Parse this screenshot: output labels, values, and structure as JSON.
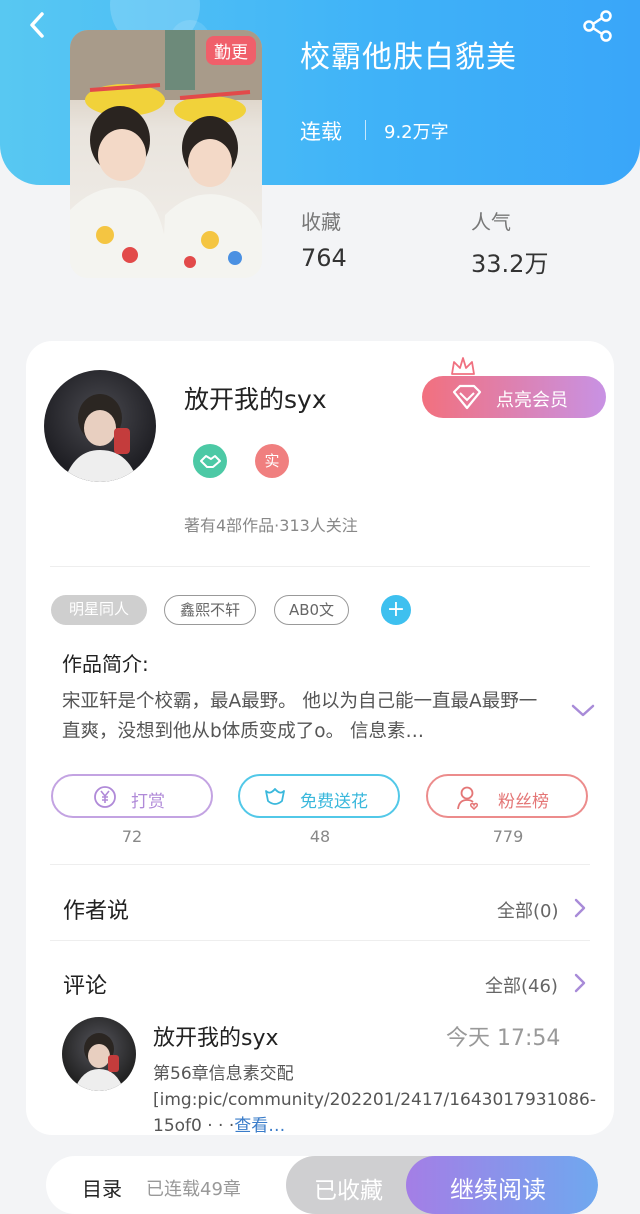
{
  "colors": {
    "header_gradient_start": "#58c8f2",
    "header_gradient_end": "#3aa6f9",
    "badge_red": "#f05f6a",
    "vip_gradient_start": "#f2707e",
    "vip_gradient_end": "#c892e4",
    "tip_purple": "#c3a3e2",
    "flower_cyan": "#52c8e8",
    "fans_red": "#ec8c8c",
    "read_gradient_start": "#a47ee6",
    "read_gradient_end": "#6fa8ef"
  },
  "header": {
    "back_icon": "chevron-left-icon",
    "share_icon": "share-icon",
    "cover_badge": "勤更",
    "title": "校霸他肤白貌美",
    "status": "连载",
    "word_count": "9.2万字"
  },
  "stats": {
    "favorites_label": "收藏",
    "favorites_value": "764",
    "popularity_label": "人气",
    "popularity_value": "33.2万"
  },
  "author": {
    "name": "放开我的syx",
    "vip_button": "点亮会员",
    "badge_real": "实",
    "meta": "著有4部作品·313人关注"
  },
  "tags": {
    "items": [
      "明星同人",
      "鑫熙不轩",
      "AB0文"
    ],
    "add_icon": "+"
  },
  "intro": {
    "heading": "作品简介:",
    "text": "宋亚轩是个校霸，最A最野。 他以为自己能一直最A最野一直爽，没想到他从b体质变成了o。 信息素…"
  },
  "actions": [
    {
      "label": "打赏",
      "count": "72"
    },
    {
      "label": "免费送花",
      "count": "48"
    },
    {
      "label": "粉丝榜",
      "count": "779"
    }
  ],
  "author_says": {
    "title": "作者说",
    "link": "全部(0)"
  },
  "comments": {
    "title": "评论",
    "link": "全部(46)",
    "first": {
      "name": "放开我的syx",
      "time": "今天 17:54",
      "text": "第56章信息素交配[img:pic/community/202201/2417/1643017931086-15of0 · · ·",
      "more": "查看…"
    }
  },
  "bottom_bar": {
    "toc": "目录",
    "chapters": "已连载49章",
    "favorited": "已收藏",
    "continue_reading": "继续阅读"
  }
}
